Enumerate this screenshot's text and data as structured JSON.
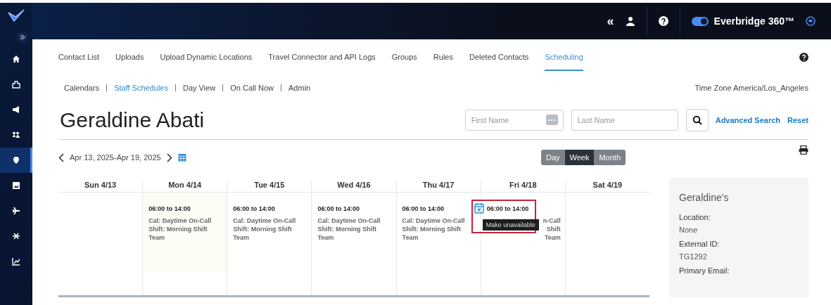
{
  "topbar": {
    "collapse": "«",
    "product": "Everbridge 360™",
    "toggle_on": true
  },
  "sidebar": {
    "items": [
      {
        "selected": false
      },
      {
        "selected": false
      },
      {
        "selected": false
      },
      {
        "selected": false
      },
      {
        "selected": true
      },
      {
        "selected": false
      },
      {
        "selected": false
      },
      {
        "selected": false
      },
      {
        "selected": false
      }
    ]
  },
  "tabs": [
    {
      "label": "Contact List",
      "selected": false
    },
    {
      "label": "Uploads",
      "selected": false
    },
    {
      "label": "Upload Dynamic Locations",
      "selected": false
    },
    {
      "label": "Travel Connector and API Logs",
      "selected": false
    },
    {
      "label": "Groups",
      "selected": false
    },
    {
      "label": "Rules",
      "selected": false
    },
    {
      "label": "Deleted Contacts",
      "selected": false
    },
    {
      "label": "Scheduling",
      "selected": true
    }
  ],
  "subnav": [
    {
      "label": "Calendars",
      "selected": false
    },
    {
      "label": "Staff Schedules",
      "selected": true
    },
    {
      "label": "Day View",
      "selected": false
    },
    {
      "label": "On Call Now",
      "selected": false
    },
    {
      "label": "Admin",
      "selected": false
    }
  ],
  "timezone": "Time Zone America/Los_Angeles",
  "title": "Geraldine Abati",
  "search": {
    "first_name": {
      "placeholder": "First Name"
    },
    "last_name": {
      "placeholder": "Last Name"
    },
    "advanced": "Advanced Search",
    "reset": "Reset"
  },
  "date_range": "Apr 13, 2025-Apr 19, 2025",
  "views": [
    {
      "label": "Day",
      "selected": false
    },
    {
      "label": "Week",
      "selected": true
    },
    {
      "label": "Month",
      "selected": false
    }
  ],
  "calendar": {
    "days": [
      {
        "heading": "Sun 4/13",
        "today": false
      },
      {
        "heading": "Mon 4/14",
        "today": true,
        "shift": {
          "time": "06:00 to 14:00",
          "lines": [
            "Cal: Daytime On-Call",
            "Shift: Morning Shift",
            "Team"
          ]
        }
      },
      {
        "heading": "Tue 4/15",
        "today": false,
        "shift": {
          "time": "06:00 to 14:00",
          "lines": [
            "Cal: Daytime On-Call",
            "Shift: Morning Shift",
            "Team"
          ]
        }
      },
      {
        "heading": "Wed 4/16",
        "today": false,
        "shift": {
          "time": "06:00 to 14:00",
          "lines": [
            "Cal: Daytime On-Call",
            "Shift: Morning Shift",
            "Team"
          ]
        }
      },
      {
        "heading": "Thu 4/17",
        "today": false,
        "shift": {
          "time": "06:00 to 14:00",
          "lines": [
            "Cal: Daytime On-Call",
            "Shift: Morning Shift",
            "Team"
          ]
        }
      },
      {
        "heading": "Fri 4/18",
        "today": false,
        "hovered": true,
        "tooltip": "Make unavailable",
        "shift": {
          "time": "06:00 to 14:00",
          "lines": [
            "n-Call",
            "Shift",
            "Team"
          ]
        }
      },
      {
        "heading": "Sat 4/19",
        "today": false
      }
    ]
  },
  "panel": {
    "title": "Geraldine's",
    "fields": [
      {
        "label": "Location:",
        "value": "None"
      },
      {
        "label": "External ID:",
        "value": "TG1292"
      },
      {
        "label": "Primary Email:"
      }
    ]
  }
}
